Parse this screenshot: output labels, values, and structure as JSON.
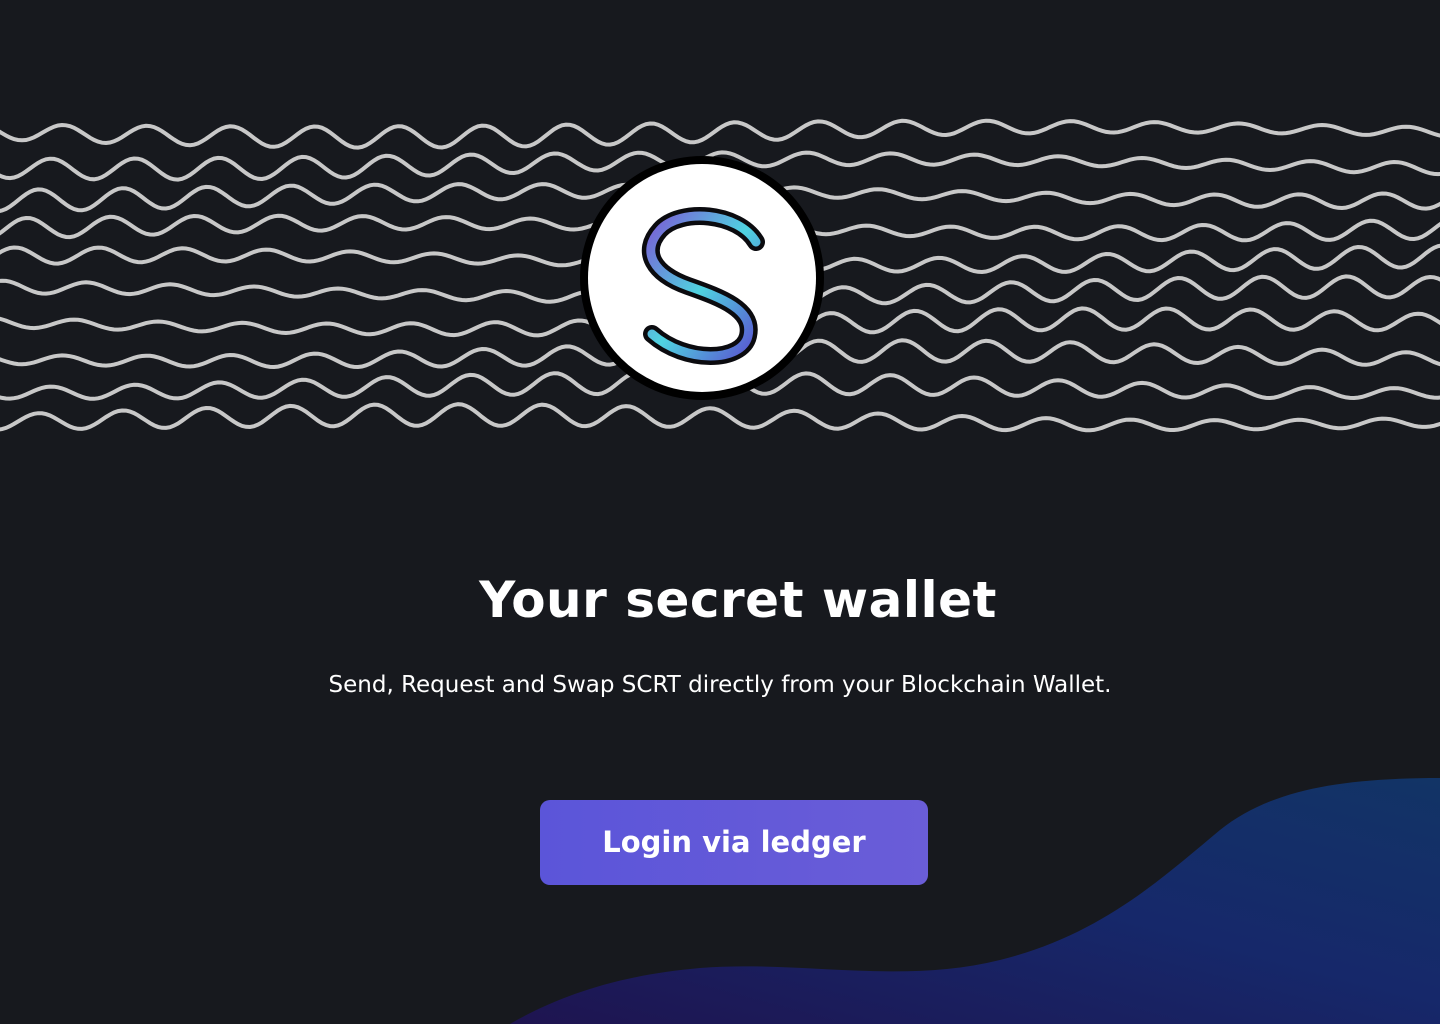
{
  "hero": {
    "title": "Your secret wallet",
    "subtitle": "Send, Request and Swap SCRT directly from your Blockchain Wallet.",
    "login_label": "Login via ledger"
  },
  "logo": {
    "icon": "secret-network-s-icon"
  },
  "colors": {
    "background": "#17191e",
    "wave_line": "#c8c8c8",
    "button": "#5b55d9",
    "blob_blue": "#123466",
    "blob_purple": "#1e1450",
    "logo_gradient_start": "#7b5cd6",
    "logo_gradient_end": "#4fd3e0"
  }
}
